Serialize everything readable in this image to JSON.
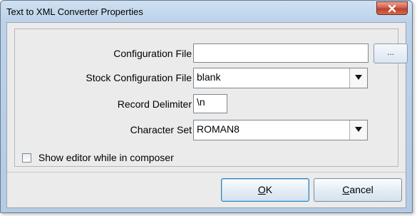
{
  "window": {
    "title": "Text to XML Converter Properties"
  },
  "form": {
    "config_file": {
      "label": "Configuration File",
      "value": "",
      "browse_label": "..."
    },
    "stock_config": {
      "label": "Stock Configuration File",
      "value": "blank"
    },
    "record_delimiter": {
      "label": "Record Delimiter",
      "value": "\\n"
    },
    "charset": {
      "label": "Character Set",
      "value": "ROMAN8"
    },
    "show_editor": {
      "label": "Show editor while in composer",
      "checked": false
    }
  },
  "buttons": {
    "ok": {
      "mnemonic": "O",
      "rest": "K"
    },
    "cancel": {
      "mnemonic": "C",
      "rest": "ancel"
    }
  },
  "icons": {
    "close": "close-icon",
    "dropdown": "chevron-down-icon"
  }
}
